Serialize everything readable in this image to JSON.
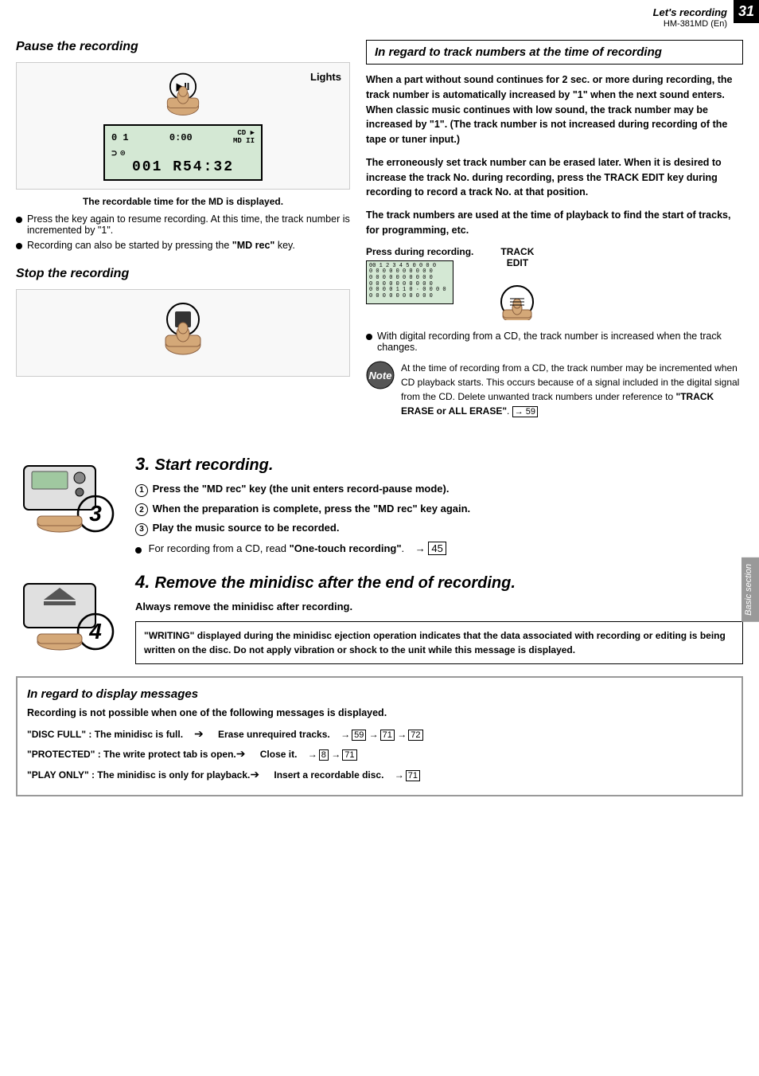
{
  "page": {
    "number": "31",
    "header": "Let's recording",
    "model": "HM-381MD (En)"
  },
  "pause_section": {
    "title": "Pause the recording",
    "lights_label": "Lights",
    "lcd": {
      "top_left": "0 1",
      "top_center": "0:00",
      "indicators": "CD ▶\nMD II",
      "symbol": "⊃",
      "bottom": "001  R54:32"
    },
    "caption": "The recordable time for the MD is displayed.",
    "bullets": [
      "Press the key again to resume recording. At this time, the track number is incremented by \"1\".",
      "Recording can also be started by pressing the \"MD rec\" key."
    ]
  },
  "stop_section": {
    "title": "Stop the recording"
  },
  "track_section": {
    "title": "In regard to track numbers at  the time of recording",
    "paragraphs": [
      "When a part without sound continues for 2 sec. or more during recording, the track number is automatically increased by \"1\" when the next sound enters. When classic music continues with low sound, the track number may be increased by \"1\". (The track number is not increased during recording of the tape or tuner input.)",
      "The erroneously set track number can be erased later. When it is desired to increase the track No. during recording, press the TRACK EDIT key during recording to record a track No. at that position.",
      "The track numbers are used at the time of playback to find the start of tracks, for programming, etc."
    ],
    "press_label": "Press during recording.",
    "track_edit_label": "TRACK\nEDIT",
    "bullet": "With digital recording from a CD, the track number is increased when the track changes.",
    "note": "At the time of recording from a CD, the track number may be incremented when CD playback starts. This occurs because of a signal included in the digital signal from the CD. Delete unwanted track numbers under reference to \"TRACK ERASE or ALL ERASE\".",
    "note_ref": "→ 59"
  },
  "step3": {
    "number": "3",
    "title": "Start recording.",
    "steps": [
      "Press the \"MD rec\" key (the unit enters record-pause mode).",
      "When the preparation is complete, press the \"MD rec\" key again.",
      "Play the music source to be recorded."
    ],
    "bullet": "For recording from a CD, read \"One-touch recording\".",
    "ref": "→ 45"
  },
  "step4": {
    "number": "4",
    "title": "Remove the minidisc after the end of recording.",
    "subtitle": "Always remove the minidisc after recording.",
    "warning": "\"WRITING\" displayed during the minidisc ejection operation indicates that the data associated with recording or editing is being written on the disc. Do not apply vibration or shock to the unit while this message is displayed."
  },
  "bottom_box": {
    "title": "In regard to display messages",
    "lead": "Recording is not possible when one of the following messages is displayed.",
    "items": [
      {
        "label": "\"DISC FULL\"   : The minidisc is full.",
        "arrow": "➔",
        "desc": "Erase unrequired tracks.",
        "refs": [
          "59",
          "71",
          "72"
        ]
      },
      {
        "label": "\"PROTECTED\" : The write protect tab is open.",
        "arrow": "➔",
        "desc": "Close it.",
        "refs": [
          "8",
          "71"
        ]
      },
      {
        "label": "\"PLAY ONLY\"  : The minidisc is only for playback.",
        "arrow": "➔",
        "desc": "Insert a recordable disc.",
        "refs": [
          "71"
        ]
      }
    ]
  },
  "side_tab": {
    "label": "Basic section"
  }
}
